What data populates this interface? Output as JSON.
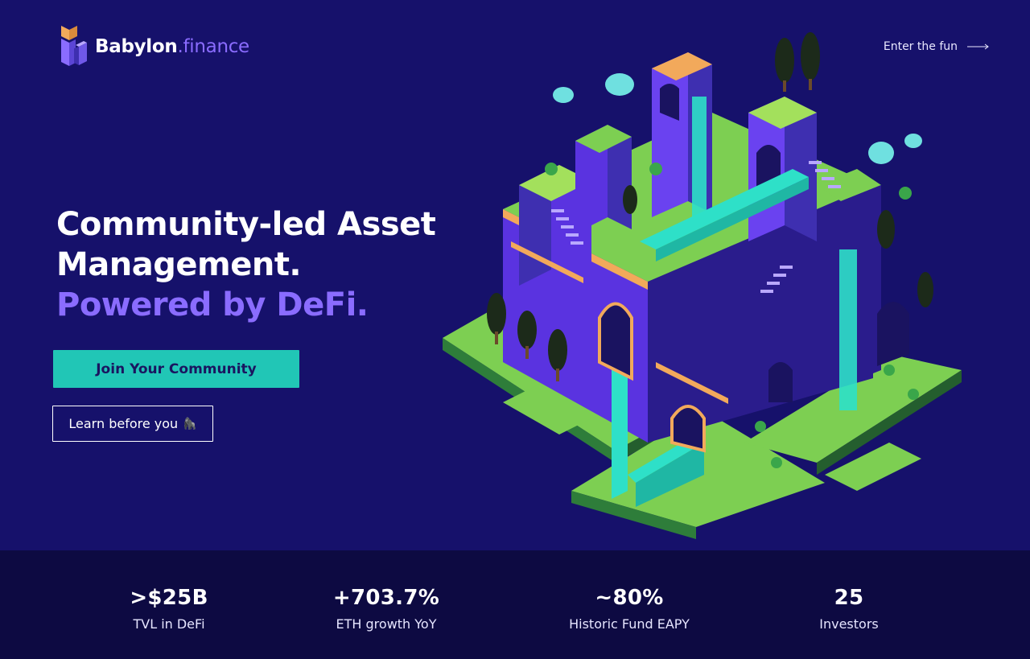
{
  "brand": {
    "name": "Babylon",
    "suffix": ".finance"
  },
  "nav": {
    "enter_link": "Enter the fun"
  },
  "hero": {
    "headline_line1": "Community-led Asset",
    "headline_line2": "Management.",
    "headline_line3": "Powered by DeFi.",
    "primary_button": "Join Your Community",
    "secondary_button": "Learn before you",
    "secondary_emoji": "🦍"
  },
  "stats": [
    {
      "value": ">$25B",
      "label": "TVL in DeFi"
    },
    {
      "value": "+703.7%",
      "label": "ETH growth YoY"
    },
    {
      "value": "~80%",
      "label": "Historic Fund EAPY"
    },
    {
      "value": "25",
      "label": "Investors"
    }
  ],
  "colors": {
    "background": "#16116b",
    "stats_background": "#0d0a42",
    "accent_purple": "#8a6cff",
    "accent_teal": "#21c6b6"
  },
  "icons": {
    "logo": "babylon-logo-icon",
    "arrow": "arrow-right-icon"
  }
}
